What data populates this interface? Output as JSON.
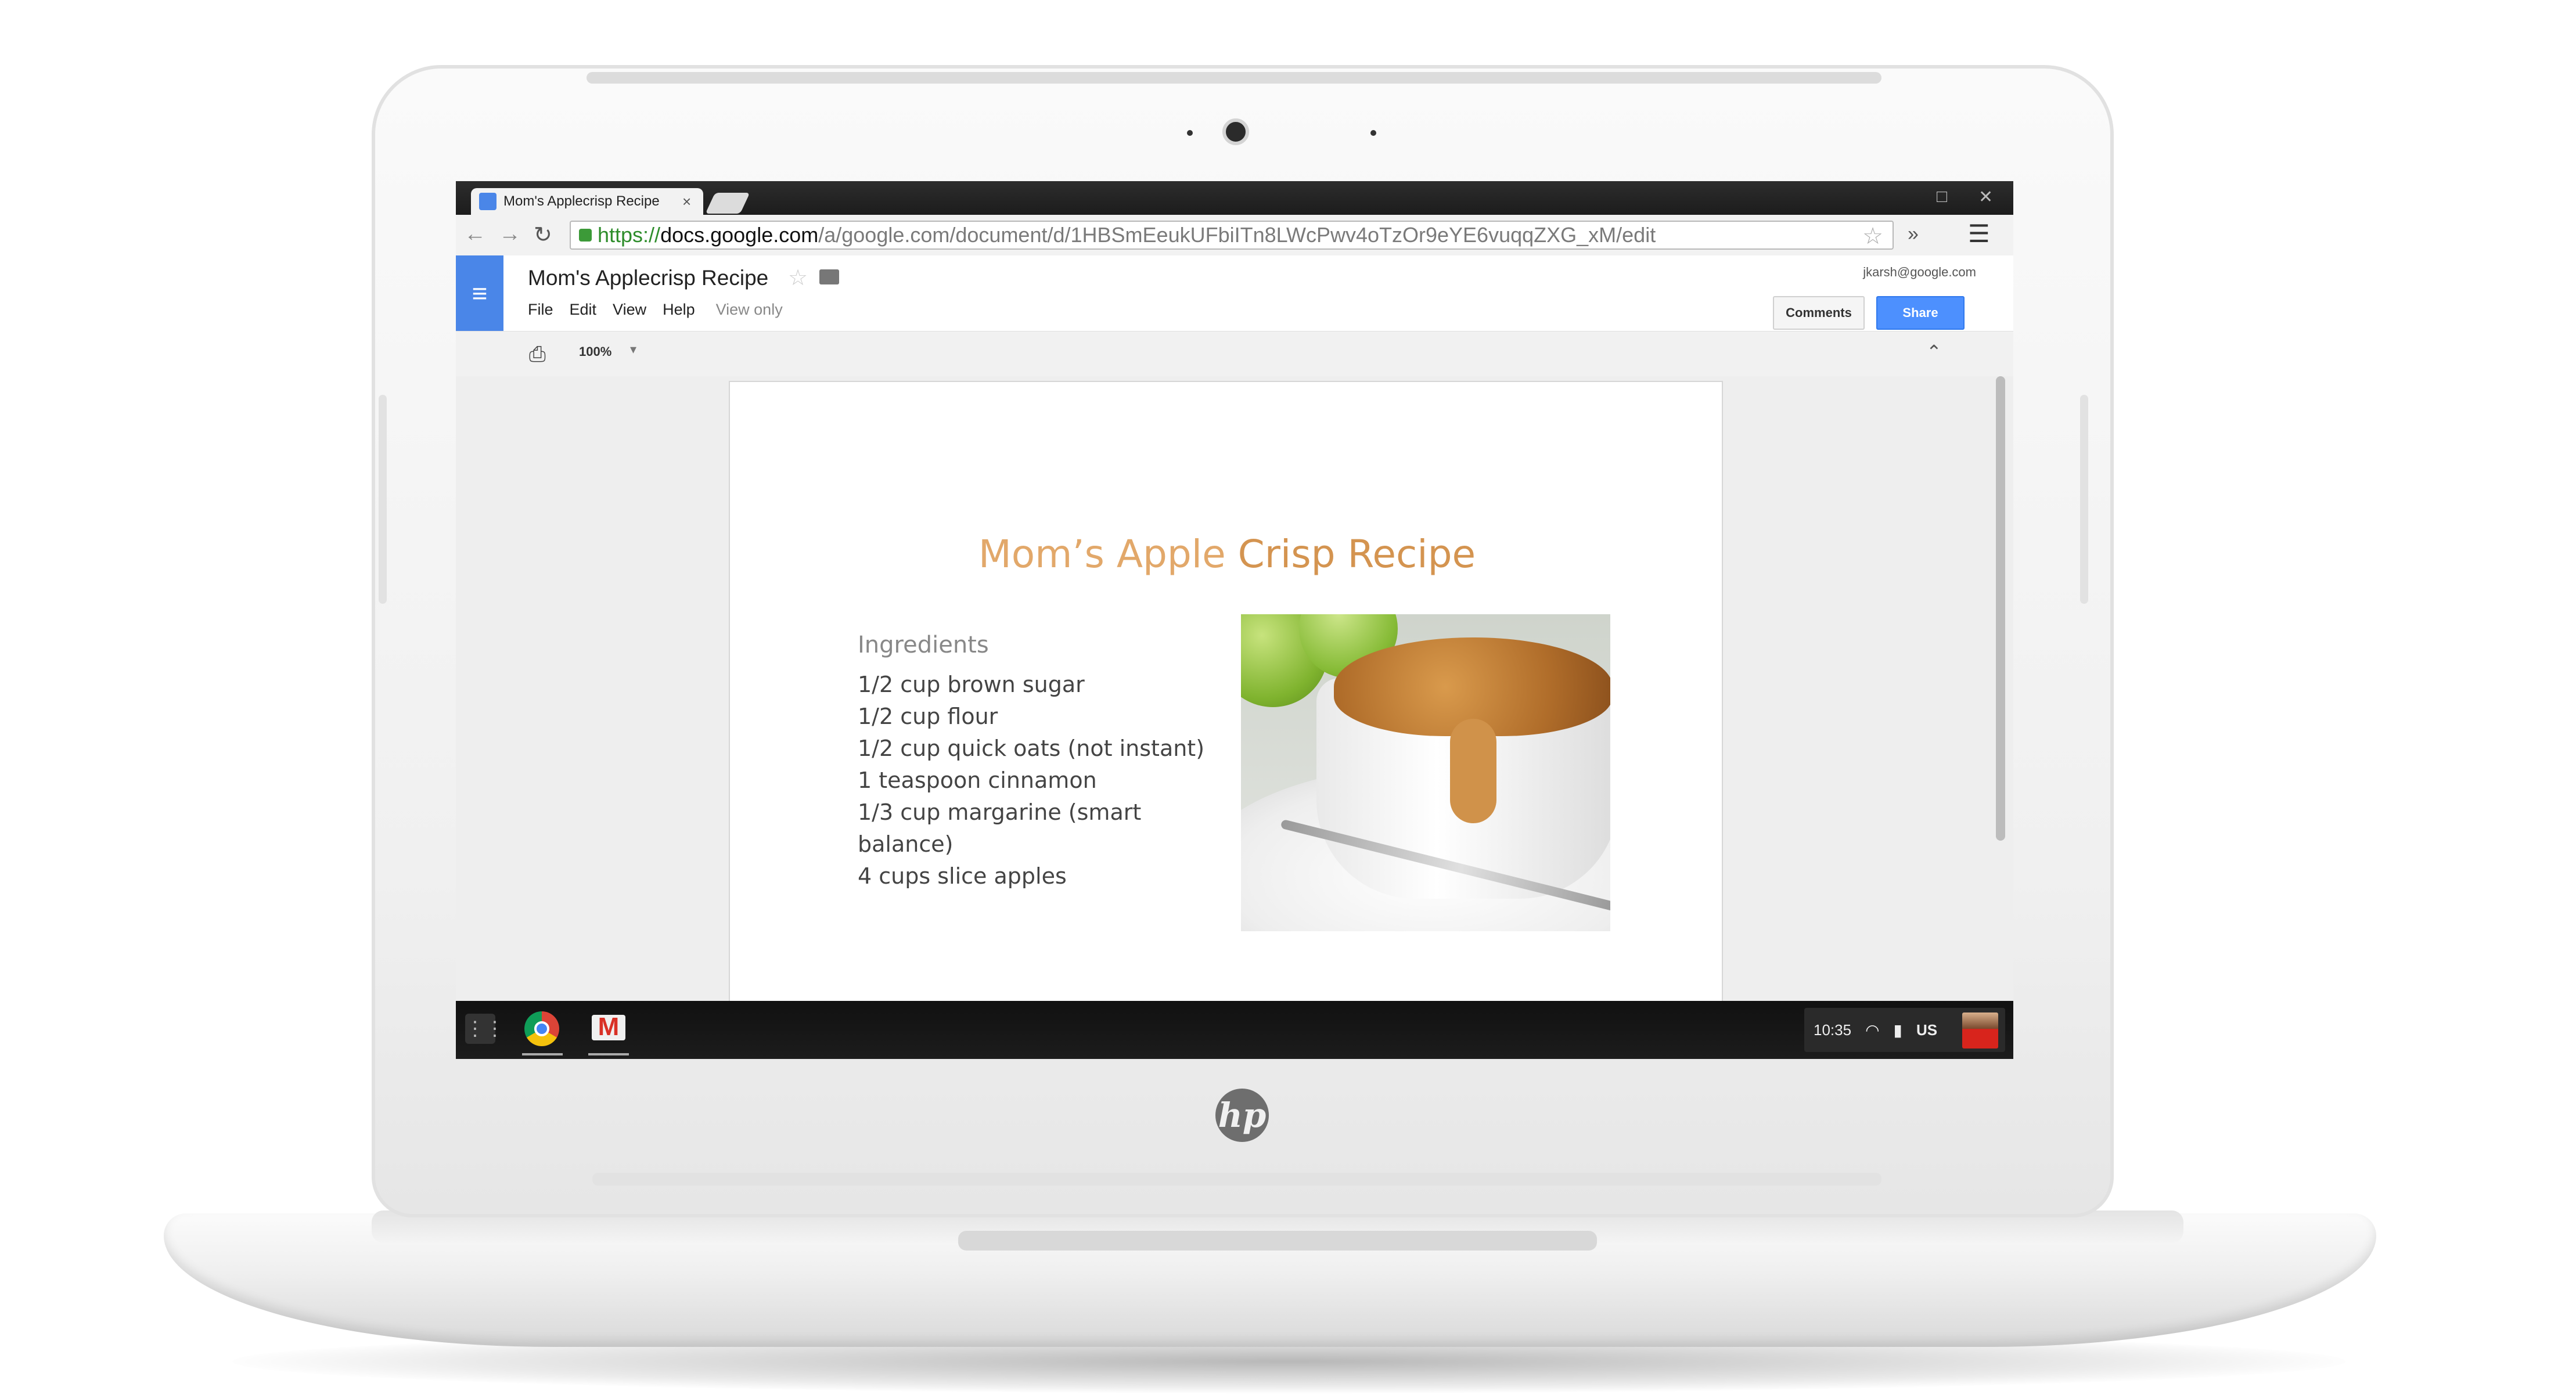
{
  "browser": {
    "tab_title": "Mom's Applecrisp Recipe",
    "tab_close": "×",
    "url_scheme": "https://",
    "url_host": "docs.google.com",
    "url_path": "/a/google.com/document/d/1HBSmEeukUFbiITn8LWcPwv4oTzOr9eYE6vuqqZXG_xM/edit",
    "extensions_label": "»",
    "window_controls": {
      "minimize": "□",
      "close": "✕"
    }
  },
  "docs": {
    "title": "Mom's Applecrisp Recipe",
    "menu": [
      "File",
      "Edit",
      "View",
      "Help"
    ],
    "view_only_label": "View only",
    "account": "jkarsh@google.com",
    "comments_label": "Comments",
    "share_label": "Share",
    "zoom": "100%"
  },
  "document": {
    "heading_part1": "Mom’s Apple",
    "heading_part2": " Crisp Recipe",
    "ingredients_heading": "Ingredients",
    "ingredients": [
      "1/2 cup brown sugar",
      "1/2 cup flour",
      "1/2 cup quick oats (not instant)",
      "1 teaspoon cinnamon",
      "1/3 cup margarine (smart balance)",
      "4 cups slice apples"
    ]
  },
  "shelf": {
    "time": "10:35",
    "keyboard_layout": "US"
  },
  "icons": {
    "back": "back-arrow-icon",
    "forward": "forward-arrow-icon",
    "reload": "reload-icon",
    "lock": "lock-icon",
    "bookmark": "star-icon",
    "print": "print-icon",
    "launcher": "app-launcher-icon"
  },
  "colors": {
    "docs_blue": "#4a86e8",
    "share_blue": "#4d90fe",
    "heading_orange": "#d49450"
  }
}
